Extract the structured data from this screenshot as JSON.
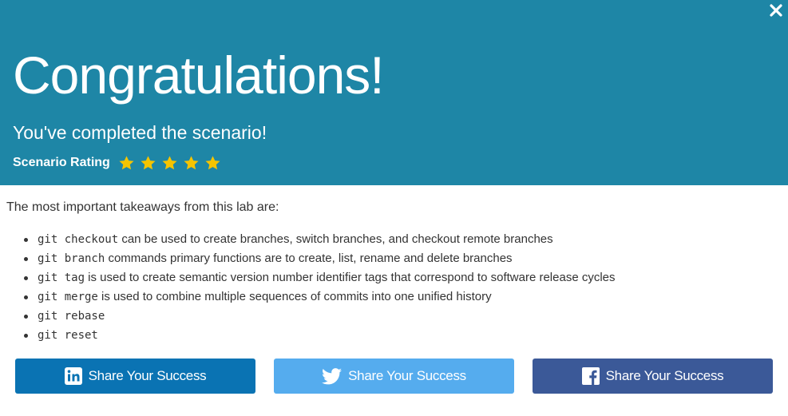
{
  "header": {
    "title": "Congratulations!",
    "subtitle": "You've completed the scenario!",
    "rating_label": "Scenario Rating",
    "rating": {
      "value": 5,
      "max": 5
    }
  },
  "content": {
    "intro": "The most important takeaways from this lab are:",
    "takeaways": [
      {
        "command": "git checkout",
        "text": " can be used to create branches, switch branches, and checkout remote branches"
      },
      {
        "command": "git branch",
        "text": " commands primary functions are to create, list, rename and delete branches"
      },
      {
        "command": "git tag",
        "text": " is used to create semantic version number identifier tags that correspond to software release cycles"
      },
      {
        "command": "git merge",
        "text": " is used to combine multiple sequences of commits into one unified history"
      },
      {
        "command": "git rebase",
        "text": ""
      },
      {
        "command": "git reset",
        "text": ""
      }
    ]
  },
  "share": {
    "linkedin_label": "Share Your Success",
    "twitter_label": "Share Your Success",
    "facebook_label": "Share Your Success"
  },
  "icons": {
    "close": "close-icon",
    "star": "star-icon",
    "linkedin": "linkedin-icon",
    "twitter": "twitter-icon",
    "facebook": "facebook-icon"
  },
  "colors": {
    "header_bg": "#1e86a6",
    "star": "#f5c400",
    "linkedin": "#0a73b3",
    "twitter": "#55acee",
    "facebook": "#3b5998"
  }
}
